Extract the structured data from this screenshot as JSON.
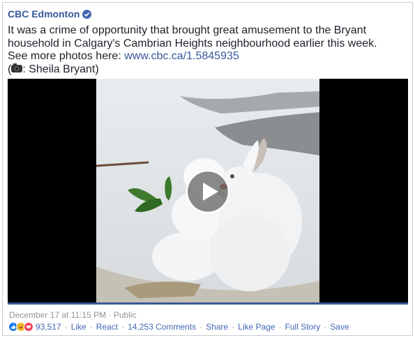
{
  "post": {
    "page_name": "CBC Edmonton",
    "text_line1": "It was a crime of opportunity that brought great amusement to the Bryant",
    "text_line2": "household in Calgary's Cambrian Heights neighbourhood earlier this week.",
    "text_line3_prefix": "See more photos here: ",
    "link_url": "www.cbc.ca/1.5845935",
    "credit_open": "(",
    "credit_text": ": Sheila Bryant)",
    "timestamp": "December 17 at 11:15 PM",
    "dot": "·",
    "privacy": "Public"
  },
  "engagement": {
    "reaction_count": "93,517",
    "like": "Like",
    "react": "React",
    "comments": "14,253 Comments",
    "share": "Share",
    "like_page": "Like Page",
    "full_story": "Full Story",
    "save": "Save",
    "separator": "·"
  },
  "colors": {
    "brand_blue": "#365899",
    "link_blue": "#4267b2",
    "meta_gray": "#90949c",
    "like_blue": "#1877f2",
    "haha_yellow": "#f7b928",
    "love_red": "#f33e58"
  },
  "icons": {
    "verified": "verified-badge-icon",
    "camera": "video-camera-icon",
    "play": "play-icon",
    "like": "like-reaction-icon",
    "haha": "haha-reaction-icon",
    "love": "love-reaction-icon"
  }
}
